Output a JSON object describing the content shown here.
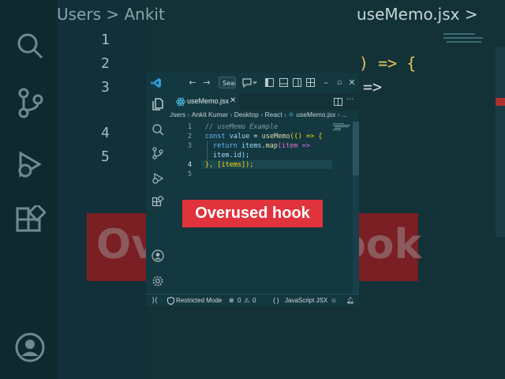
{
  "background": {
    "breadcrumb_left": "Users > Ankit",
    "breadcrumb_right": "useMemo.jsx >",
    "line_numbers": [
      "1",
      "2",
      "3",
      "4",
      "5"
    ],
    "code_fragment_1": ") => {",
    "code_fragment_2": "=>",
    "banner_left": "Ov",
    "banner_right": "ook"
  },
  "titlebar": {
    "search_placeholder": "Sear",
    "colors": {
      "accent": "#2f9fe0"
    }
  },
  "activity_bar": {
    "items": [
      "explorer-icon",
      "search-icon",
      "source-control-icon",
      "run-debug-icon",
      "extensions-icon"
    ],
    "bottom_items": [
      "account-icon",
      "settings-gear-icon"
    ]
  },
  "tab": {
    "label": "useMemo.jsx",
    "close": "✕"
  },
  "breadcrumb": {
    "items": [
      "Users",
      "Ankit Kumar",
      "Desktop",
      "React",
      "useMemo.jsx",
      "..."
    ]
  },
  "editor": {
    "line_numbers": [
      "1",
      "2",
      "3",
      "4",
      "5"
    ],
    "active_line": "4",
    "lines": [
      {
        "comment": "// useMemo Example"
      },
      {
        "kw": "const",
        "var": "value",
        "op": " = ",
        "fn": "useMemo",
        "rest": "(() => {"
      },
      {
        "kw": "return",
        "var": "items",
        "fn": "map",
        "rest": "(item =>"
      },
      {
        "cont": "item.id);"
      },
      {
        "close": "}, [items]);"
      }
    ]
  },
  "statusbar": {
    "remote_icon": "remote-icon",
    "mode": "Restricted Mode",
    "errors": "0",
    "warnings": "0",
    "braces": "{ }",
    "language": "JavaScript JSX"
  },
  "caption": {
    "text": "Overused hook",
    "color": "#e0333c"
  }
}
